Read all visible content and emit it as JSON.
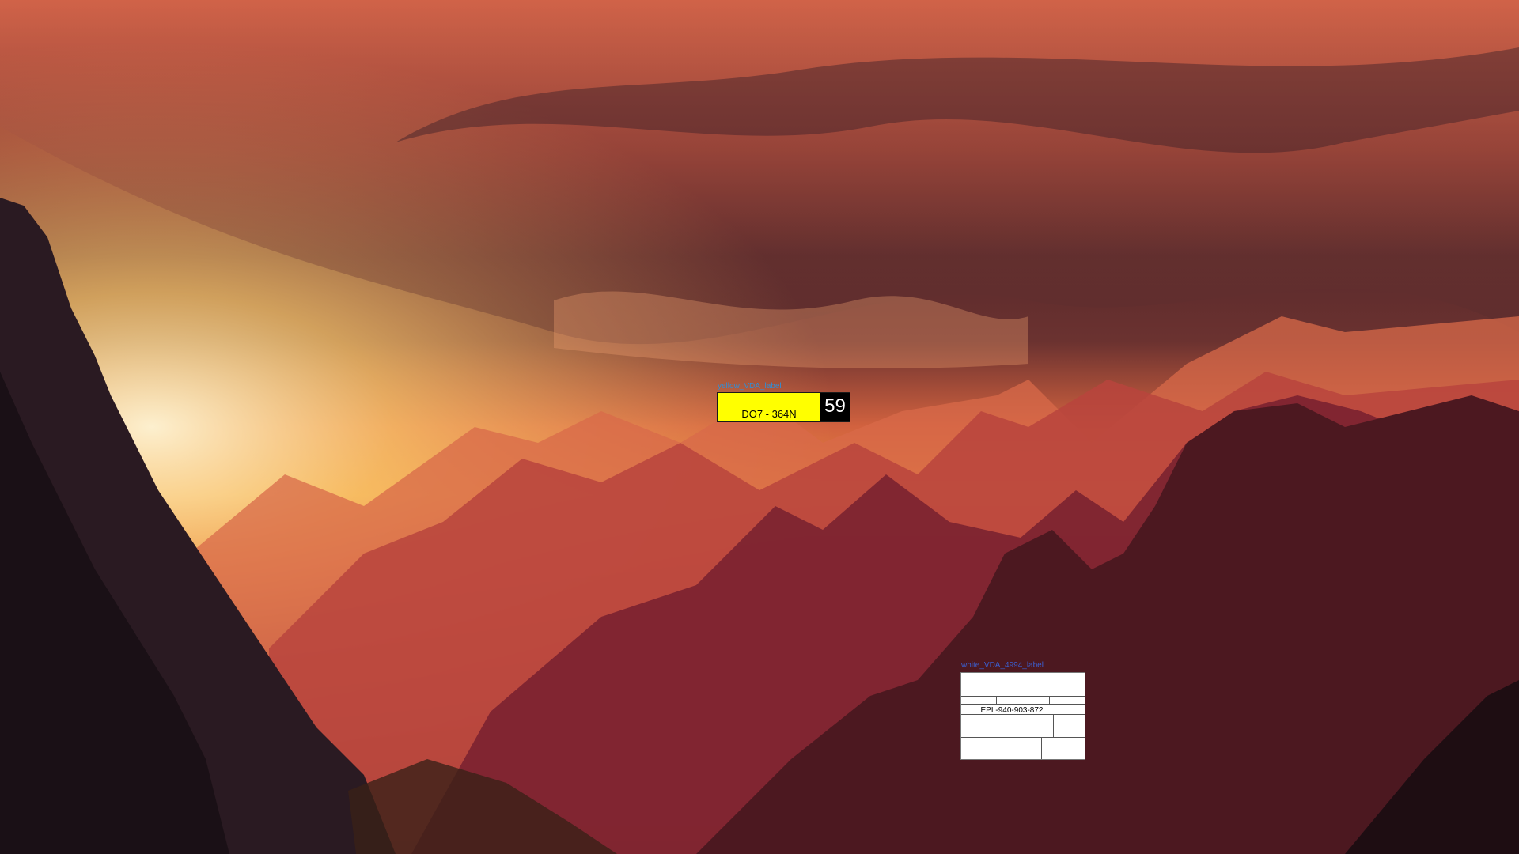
{
  "yellow_label": {
    "title": "yellow_VDA_label",
    "plate": "DO7 - 364N",
    "count": "59",
    "colors": {
      "plate_bg": "#ffff00",
      "count_bg": "#000000"
    }
  },
  "white_label": {
    "title": "white_VDA_4994_label",
    "code": "EPL-940-903-872"
  }
}
